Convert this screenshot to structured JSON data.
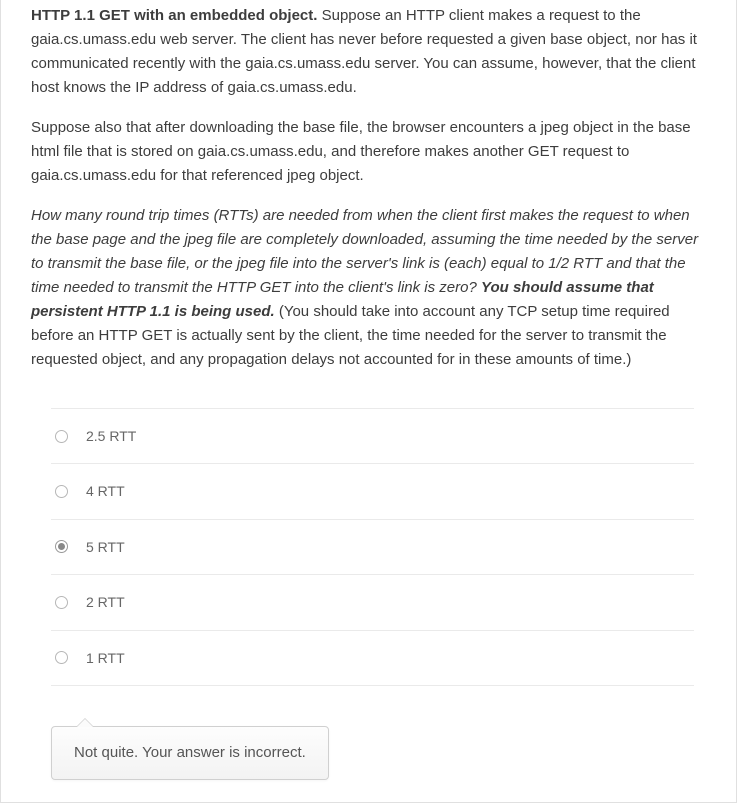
{
  "question": {
    "p1_bold": "HTTP 1.1 GET with an embedded object.",
    "p1_rest": " Suppose an HTTP client makes a request to the gaia.cs.umass.edu web server.  The client has never before requested a given base object, nor has it communicated recently with the gaia.cs.umass.edu server. You can assume, however, that the client host knows the IP address of gaia.cs.umass.edu.",
    "p2": "Suppose also that after downloading the base file, the browser encounters a jpeg object in the base html file that is stored on gaia.cs.umass.edu, and therefore makes another GET request to gaia.cs.umass.edu for that referenced jpeg object.",
    "p3_italic_a": "How many round trip times (RTTs) are needed from when the client first makes the request to when the base page and the jpeg file are completely downloaded, assuming the time needed by the server to transmit the base file, or the jpeg file into the server's link is (each) equal to 1/2 RTT and that the time needed to transmit the HTTP GET into the client's link is zero? ",
    "p3_bold_italic": "You should assume that persistent HTTP 1.1 is being used.",
    "p3_rest": "  (You should take into account any TCP setup time required before an HTTP GET is actually sent by the client,  the time needed for the server to transmit the requested object, and any propagation delays not accounted for in these amounts of time.)"
  },
  "options": [
    {
      "label": "2.5 RTT",
      "selected": false
    },
    {
      "label": "4 RTT",
      "selected": false
    },
    {
      "label": "5 RTT",
      "selected": true
    },
    {
      "label": "2 RTT",
      "selected": false
    },
    {
      "label": "1 RTT",
      "selected": false
    }
  ],
  "feedback": "Not quite. Your answer is incorrect."
}
